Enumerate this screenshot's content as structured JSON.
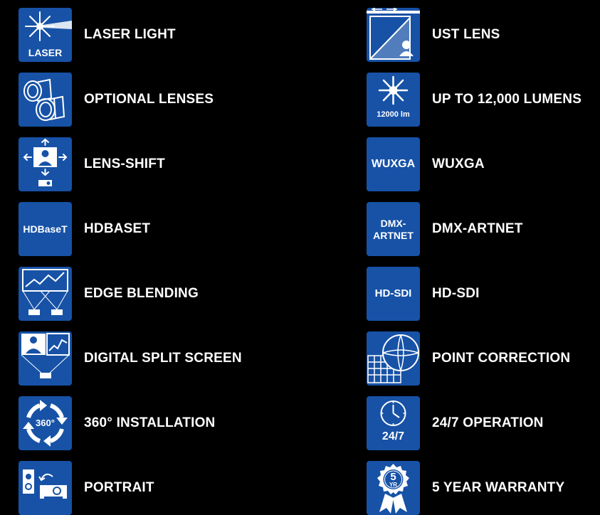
{
  "colors": {
    "background": "#000000",
    "tile": "#1752a6",
    "text": "#ffffff"
  },
  "left_features": [
    {
      "label": "LASER LIGHT",
      "icon": "laser-icon",
      "icon_text": "LASER"
    },
    {
      "label": "OPTIONAL LENSES",
      "icon": "lenses-icon"
    },
    {
      "label": "LENS-SHIFT",
      "icon": "lens-shift-icon"
    },
    {
      "label": "HDBASET",
      "icon": "hdbaset-icon",
      "icon_text": "HDBaseT"
    },
    {
      "label": "EDGE BLENDING",
      "icon": "edge-blending-icon"
    },
    {
      "label": "DIGITAL SPLIT SCREEN",
      "icon": "split-screen-icon"
    },
    {
      "label": "360° INSTALLATION",
      "icon": "rotation-360-icon",
      "icon_text": "360°"
    },
    {
      "label": "PORTRAIT",
      "icon": "portrait-icon"
    }
  ],
  "right_features": [
    {
      "label": "UST LENS",
      "icon": "ust-lens-icon"
    },
    {
      "label": "UP TO 12,000 LUMENS",
      "icon": "lumens-icon",
      "icon_text": "12000 lm"
    },
    {
      "label": "WUXGA",
      "icon": "wuxga-icon",
      "icon_text": "WUXGA"
    },
    {
      "label": "DMX-ARTNET",
      "icon": "dmx-artnet-icon",
      "icon_text_line1": "DMX-",
      "icon_text_line2": "ARTNET"
    },
    {
      "label": "HD-SDI",
      "icon": "hd-sdi-icon",
      "icon_text": "HD-SDI"
    },
    {
      "label": "POINT CORRECTION",
      "icon": "point-correction-icon"
    },
    {
      "label": "24/7 OPERATION",
      "icon": "clock-24-7-icon",
      "icon_text": "24/7"
    },
    {
      "label": "5 YEAR WARRANTY",
      "icon": "warranty-badge-icon",
      "icon_text_top": "5",
      "icon_text_bottom": "YR"
    }
  ]
}
